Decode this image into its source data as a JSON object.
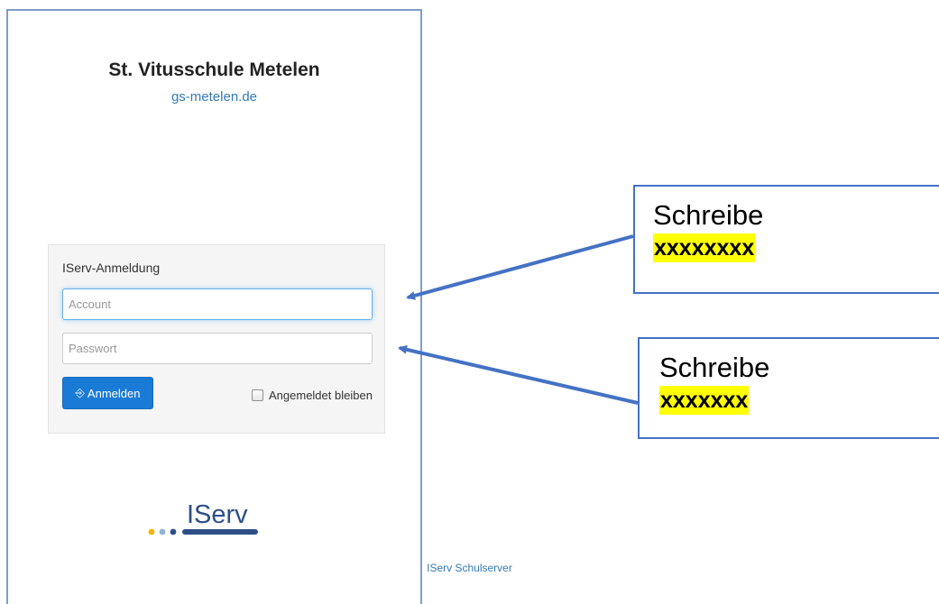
{
  "school": {
    "name": "St. Vitusschule Metelen",
    "url": "gs-metelen.de"
  },
  "login": {
    "title": "IServ-Anmeldung",
    "account_placeholder": "Account",
    "account_value": "",
    "password_placeholder": "Passwort",
    "password_value": "",
    "submit_label": "Anmelden",
    "submit_icon": "sign-in-icon",
    "remember_label": "Angemeldet bleiben",
    "remember_checked": false
  },
  "branding": {
    "logo_text": "IServ",
    "footer_link": "IServ Schulserver",
    "dot_colors": [
      "#f3b600",
      "#8fb3d9",
      "#2d4f87"
    ],
    "accent": "#1a7bd6"
  },
  "annotations": [
    {
      "label": "Schreibe",
      "highlight": "xxxxxxxx"
    },
    {
      "label": "Schreibe",
      "highlight": "xxxxxxx"
    }
  ],
  "colors": {
    "highlight": "#ffff00",
    "callout_border": "#4472c4",
    "arrow": "#4472c4",
    "link": "#337ab7"
  }
}
